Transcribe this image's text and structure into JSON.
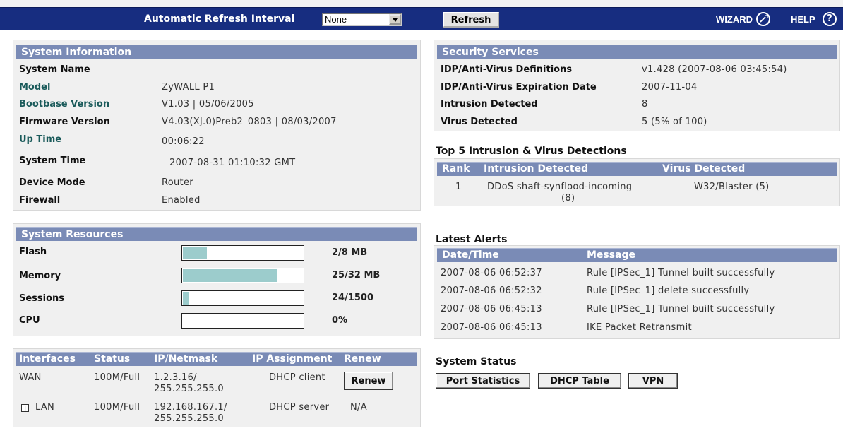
{
  "topbar": {
    "refresh_interval_label": "Automatic Refresh Interval",
    "refresh_interval_value": "None",
    "refresh_button": "Refresh",
    "wizard_label": "WIZARD",
    "help_label": "HELP",
    "help_glyph": "?"
  },
  "system_information": {
    "title": "System Information",
    "rows": [
      {
        "label": "System Name",
        "value": ""
      },
      {
        "label": "Model",
        "value": "ZyWALL P1"
      },
      {
        "label": "Bootbase Version",
        "value": "V1.03 | 05/06/2005"
      },
      {
        "label": "Firmware Version",
        "value": "V4.03(XJ.0)Preb2_0803 | 08/03/2007"
      },
      {
        "label": "Up Time",
        "value": "00:06:22"
      },
      {
        "label": "System Time",
        "value": "2007-08-31 01:10:32 GMT"
      },
      {
        "label": "Device Mode",
        "value": "Router"
      },
      {
        "label": "Firewall",
        "value": "Enabled"
      }
    ]
  },
  "system_resources": {
    "title": "System Resources",
    "rows": [
      {
        "label": "Flash",
        "value": "2/8 MB",
        "fill_fraction": 0.2
      },
      {
        "label": "Memory",
        "value": "25/32 MB",
        "fill_fraction": 0.78
      },
      {
        "label": "Sessions",
        "value": "24/1500",
        "fill_fraction": 0.05
      },
      {
        "label": "CPU",
        "value": "0%",
        "fill_fraction": 0.0
      }
    ]
  },
  "interfaces": {
    "headers": [
      "Interfaces",
      "Status",
      "IP/Netmask",
      "IP Assignment",
      "Renew"
    ],
    "rows": [
      {
        "name": "WAN",
        "status": "100M/Full",
        "ip": "1.2.3.16/",
        "netmask": "255.255.255.0",
        "assignment": "DHCP client",
        "renew": "Renew"
      },
      {
        "name": "LAN",
        "status": "100M/Full",
        "ip": "192.168.167.1/",
        "netmask": "255.255.255.0",
        "assignment": "DHCP server",
        "renew": "N/A"
      }
    ]
  },
  "security_services": {
    "title": "Security Services",
    "rows": [
      {
        "label": "IDP/Anti-Virus Definitions",
        "value": "v1.428 (2007-08-06 03:45:54)"
      },
      {
        "label": "IDP/Anti-Virus Expiration Date",
        "value": "2007-11-04"
      },
      {
        "label": "Intrusion Detected",
        "value": "8"
      },
      {
        "label": "Virus Detected",
        "value": "5 (5% of 100)"
      }
    ]
  },
  "top5": {
    "title": "Top 5 Intrusion & Virus Detections",
    "headers": [
      "Rank",
      "Intrusion Detected",
      "Virus Detected"
    ],
    "rows": [
      {
        "rank": "1",
        "intrusion_line1": "DDoS shaft-synflood-incoming",
        "intrusion_line2": "(8)",
        "virus": "W32/Blaster (5)"
      }
    ]
  },
  "latest_alerts": {
    "title": "Latest Alerts",
    "headers": [
      "Date/Time",
      "Message"
    ],
    "rows": [
      {
        "time": "2007-08-06 06:52:37",
        "message": "Rule [IPSec_1] Tunnel built successfully"
      },
      {
        "time": "2007-08-06 06:52:32",
        "message": "Rule [IPSec_1] delete successfully"
      },
      {
        "time": "2007-08-06 06:45:13",
        "message": "Rule [IPSec_1] Tunnel built successfully"
      },
      {
        "time": "2007-08-06 06:45:13",
        "message": "IKE Packet Retransmit"
      }
    ]
  },
  "system_status": {
    "title": "System Status",
    "buttons": [
      "Port Statistics",
      "DHCP Table",
      "VPN"
    ]
  },
  "colors": {
    "topbar": "#172d80",
    "section_header": "#7a8bb6",
    "bar_fill": "#9ccccc",
    "panel_bg": "#f0f0f0"
  }
}
